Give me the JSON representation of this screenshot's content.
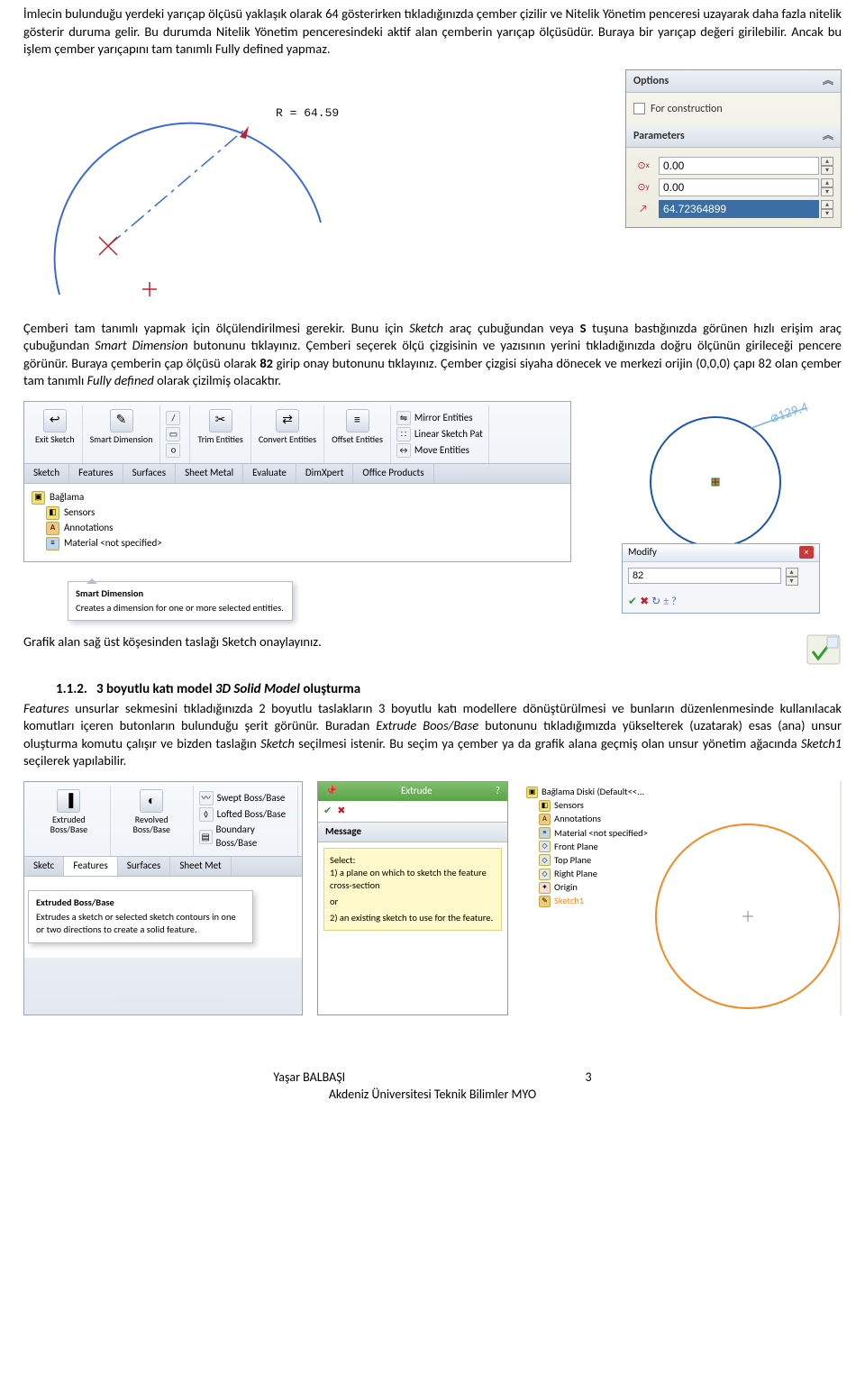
{
  "para1": "İmlecin bulunduğu yerdeki yarıçap ölçüsü yaklaşık olarak 64 gösterirken tıkladığınızda çember çizilir ve Nitelik Yönetim penceresi uzayarak daha fazla nitelik gösterir duruma gelir. Bu durumda Nitelik Yönetim penceresindeki aktif alan çemberin yarıçap ölçüsüdür. Buraya bir yarıçap değeri girilebilir. Ancak bu işlem çember yarıçapını tam tanımlı Fully defined yapmaz.",
  "arc": {
    "radius_label": "R = 64.59"
  },
  "params_panel": {
    "options": "Options",
    "for_construction": "For construction",
    "parameters": "Parameters",
    "x": "0.00",
    "y": "0.00",
    "r": "64.72364899"
  },
  "para2_pre": "Çemberi tam tanımlı yapmak için ölçülendirilmesi gerekir. Bunu için ",
  "para2_sketch": "Sketch",
  "para2_mid": " araç çubuğundan veya ",
  "para2_s": "S",
  "para2_mid2": " tuşuna bastığınızda görünen hızlı erişim araç çubuğundan ",
  "para2_smart": "Smart Dimension",
  "para2_aftersd": " butonunu tıklayınız. Çemberi seçerek ölçü çizgisinin ve yazısının yerini tıkladığınızda doğru ölçünün girileceği pencere görünür. Buraya çemberin çap ölçüsü olarak ",
  "para2_82": "82",
  "para2_after82": " girip onay butonunu tıklayınız. Çember çizgisi siyaha dönecek ve merkezi orijin (0,0,0) çapı 82 olan çember tam tanımlı ",
  "para2_fully": "Fully defined",
  "para2_end": " olarak çizilmiş olacaktır.",
  "toolbar": {
    "exit": "Exit\nSketch",
    "smart": "Smart\nDimension",
    "trim": "Trim\nEntities",
    "convert": "Convert\nEntities",
    "offset": "Offset\nEntities",
    "mirror": "Mirror Entities",
    "linear": "Linear Sketch Pat",
    "move": "Move Entities",
    "tabs": [
      "Sketch",
      "Features",
      "Surfaces",
      "Sheet Metal",
      "Evaluate",
      "DimXpert",
      "Office Products"
    ]
  },
  "tree": {
    "baglama": "Bağlama",
    "sensors": "Sensors",
    "annot": "Annotations",
    "material": "Material <not specified>"
  },
  "callout": {
    "title": "Smart Dimension",
    "desc": "Creates a dimension for one or more selected entities."
  },
  "dim_label": "⌀129.4",
  "modify": {
    "title": "Modify",
    "value": "82"
  },
  "para3": "Grafik alan sağ üst köşesinden taslağı Sketch onaylayınız.",
  "heading_num": "1.1.2.",
  "heading_txt_a": "3 boyutlu katı model ",
  "heading_txt_i": "3D Solid Model",
  "heading_txt_b": " oluşturma",
  "para4_a": "Features",
  "para4_b": " unsurlar sekmesini tıkladığınızda 2 boyutlu taslakların 3 boyutlu katı modellere dönüştürülmesi ve bunların düzenlenmesinde kullanılacak komutları içeren butonların bulunduğu şerit görünür. Buradan ",
  "para4_c": "Extrude Boos/Base",
  "para4_d": " butonunu tıkladığımızda yükselterek (uzatarak) esas (ana) unsur oluşturma komutu çalışır ve bizden taslağın ",
  "para4_e": "Sketch",
  "para4_f": " seçilmesi istenir. Bu seçim ya çember ya da grafik alana geçmiş olan unsur yönetim ağacında ",
  "para4_g": "Sketch1",
  "para4_h": " seçilerek yapılabilir.",
  "features_tb": {
    "extruded": "Extruded\nBoss/Base",
    "revolved": "Revolved\nBoss/Base",
    "swept": "Swept Boss/Base",
    "lofted": "Lofted Boss/Base",
    "boundary": "Boundary Boss/Base",
    "tabs": [
      "Sketc",
      "Features",
      "Surfaces",
      "Sheet Met"
    ]
  },
  "callout2": {
    "title": "Extruded Boss/Base",
    "desc": "Extrudes a sketch or selected sketch contours in one or two directions to create a solid feature."
  },
  "extrude_pm": {
    "title": "Extrude",
    "msg": "Message",
    "body1": "Select:",
    "body2": "1) a plane on which to sketch the feature cross-section",
    "body3": "or",
    "body4": "2) an existing sketch to use for the feature."
  },
  "tree2": {
    "root": "Bağlama Diski  (Default<<...",
    "sensors": "Sensors",
    "annot": "Annotations",
    "material": "Material <not specified>",
    "front": "Front Plane",
    "top": "Top Plane",
    "right": "Right Plane",
    "origin": "Origin",
    "sketch1": "Sketch1"
  },
  "footer1": "Yaşar BALBAŞI",
  "footer_page": "3",
  "footer2": "Akdeniz Üniversitesi Teknik Bilimler MYO"
}
